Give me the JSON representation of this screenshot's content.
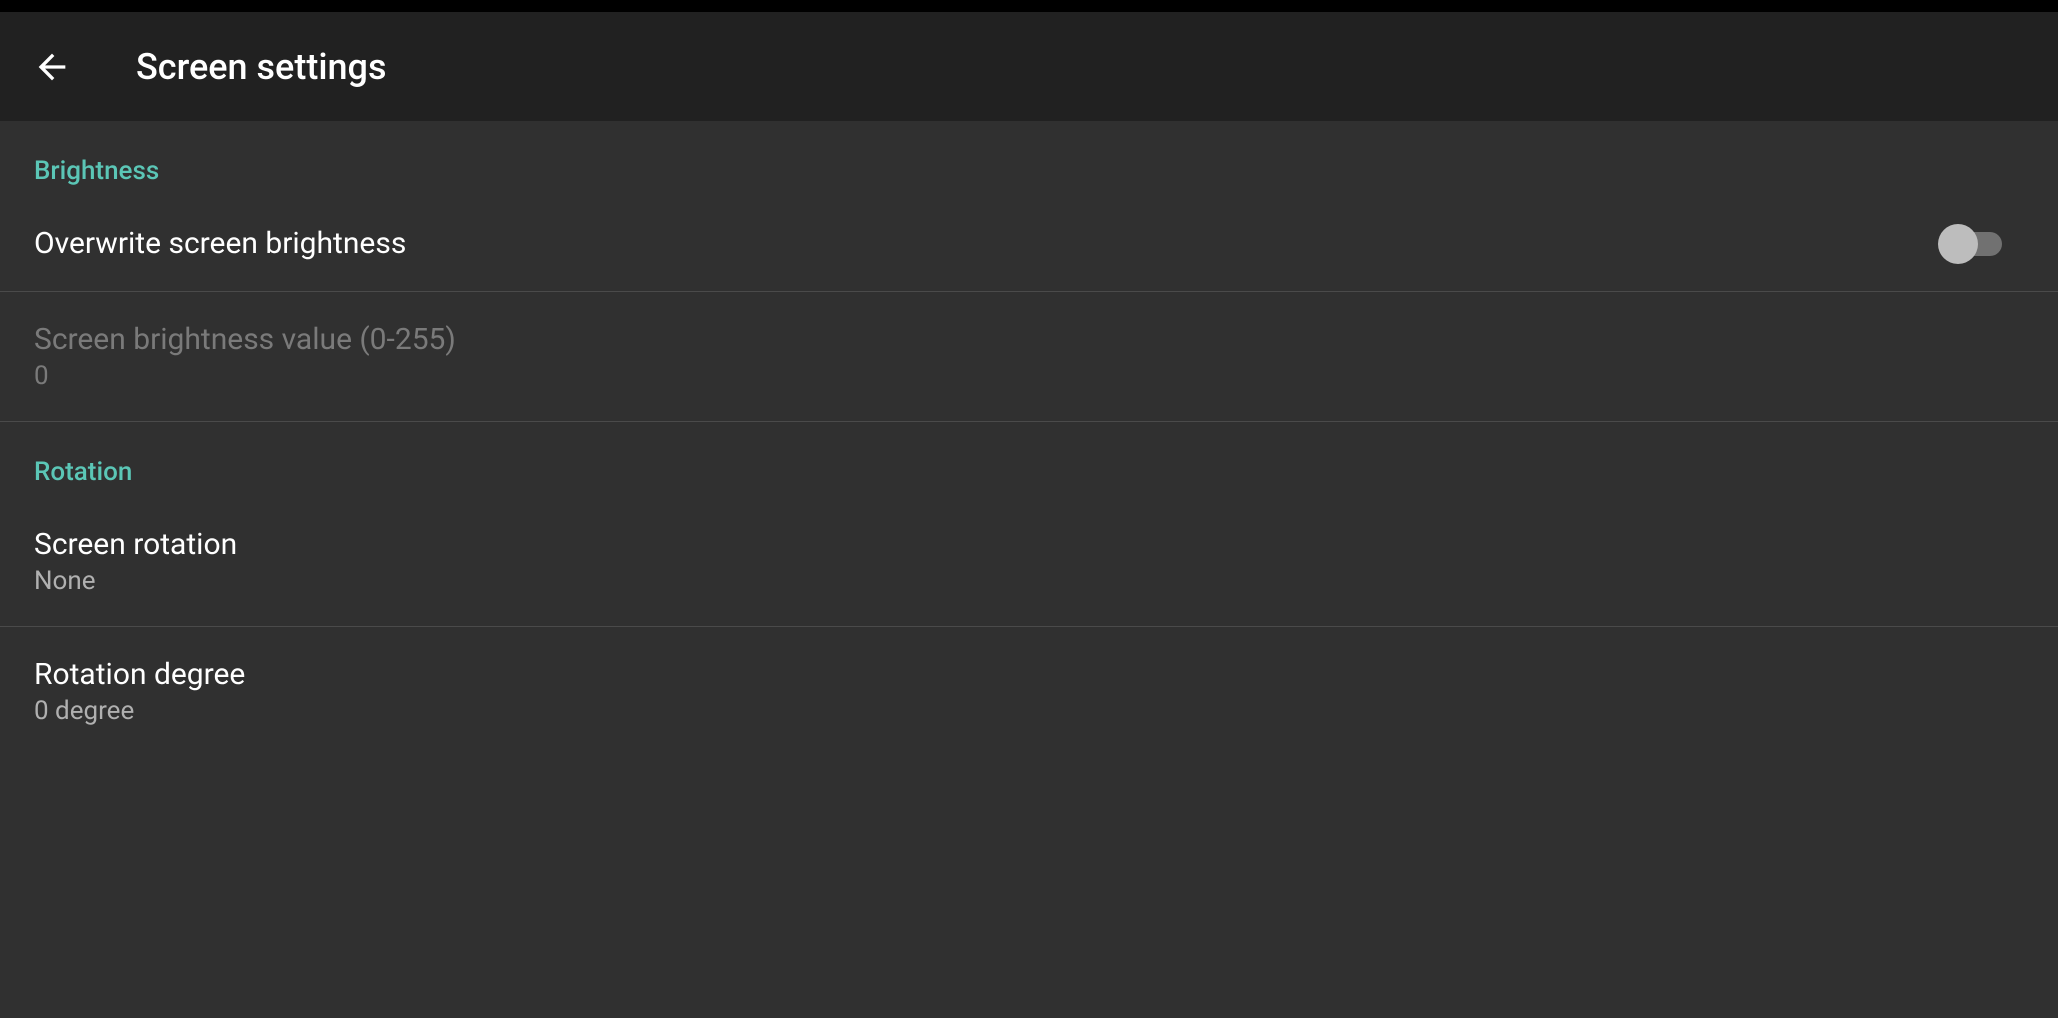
{
  "header": {
    "title": "Screen settings"
  },
  "sections": {
    "brightness": {
      "header": "Brightness",
      "overwrite": {
        "label": "Overwrite screen brightness",
        "enabled": false
      },
      "value": {
        "label": "Screen brightness value (0-255)",
        "value": "0"
      }
    },
    "rotation": {
      "header": "Rotation",
      "screen_rotation": {
        "label": "Screen rotation",
        "value": "None"
      },
      "rotation_degree": {
        "label": "Rotation degree",
        "value": "0 degree"
      }
    }
  }
}
